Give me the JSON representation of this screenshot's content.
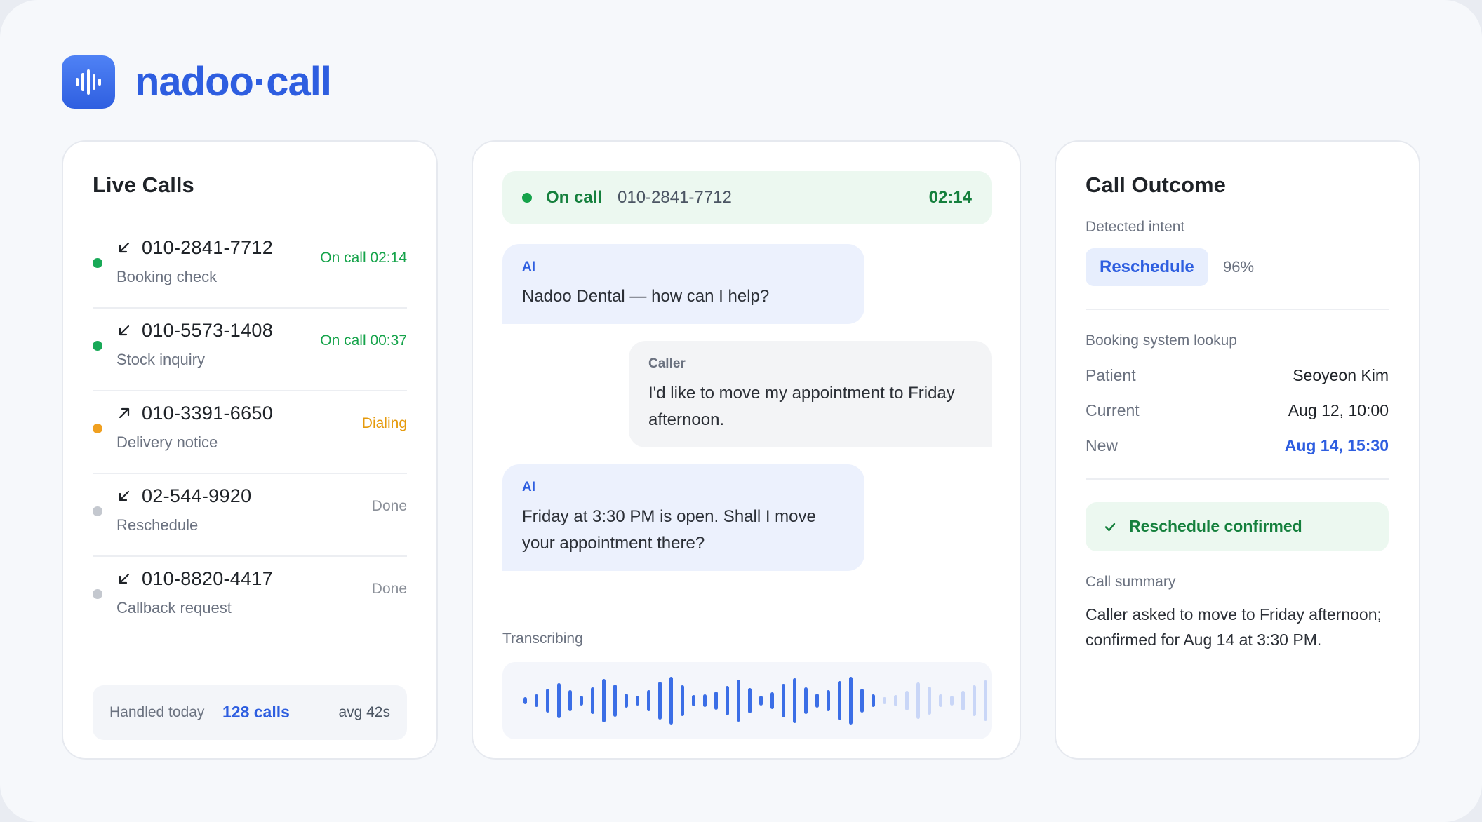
{
  "brand": {
    "name": "nadoo·call",
    "logo_icon": "sound-wave-icon",
    "accent": "#2e5ee0"
  },
  "live_calls": {
    "title": "Live Calls",
    "items": [
      {
        "number": "010-2841-7712",
        "description": "Booking check",
        "status": "On call 02:14",
        "direction": "inbound",
        "state": "active"
      },
      {
        "number": "010-5573-1408",
        "description": "Stock inquiry",
        "status": "On call 00:37",
        "direction": "inbound",
        "state": "active"
      },
      {
        "number": "010-3391-6650",
        "description": "Delivery notice",
        "status": "Dialing",
        "direction": "outbound",
        "state": "dialing"
      },
      {
        "number": "02-544-9920",
        "description": "Reschedule",
        "status": "Done",
        "direction": "inbound",
        "state": "done"
      },
      {
        "number": "010-8820-4417",
        "description": "Callback request",
        "status": "Done",
        "direction": "inbound",
        "state": "done"
      }
    ],
    "footer": {
      "label": "Handled today",
      "count": "128 calls",
      "avg": "avg 42s"
    }
  },
  "conversation": {
    "status_label": "On call",
    "number": "010-2841-7712",
    "timer": "02:14",
    "messages": [
      {
        "role": "AI",
        "text": "Nadoo Dental — how can I help?"
      },
      {
        "role": "Caller",
        "text": "I'd like to move my appointment to Friday afternoon."
      },
      {
        "role": "AI",
        "text": "Friday at 3:30 PM is open. Shall I move your appointment there?"
      }
    ],
    "transcribing_label": "Transcribing"
  },
  "outcome": {
    "title": "Call Outcome",
    "intent_label": "Detected intent",
    "intent": "Reschedule",
    "confidence": "96%",
    "lookup_label": "Booking system lookup",
    "rows": [
      {
        "key": "Patient",
        "value": "Seoyeon Kim"
      },
      {
        "key": "Current",
        "value": "Aug 12, 10:00"
      },
      {
        "key": "New",
        "value": "Aug 14, 15:30"
      }
    ],
    "confirmation": "Reschedule confirmed",
    "summary_label": "Call summary",
    "summary": "Caller asked to move to Friday afternoon; confirmed for Aug 14 at 3:30 PM."
  },
  "colors": {
    "active": "#18a957",
    "dialing": "#f0a020",
    "done": "#c4c8cf",
    "active_text": "#15a34a",
    "dialing_text": "#e59a0c",
    "done_text": "#8b9099"
  }
}
